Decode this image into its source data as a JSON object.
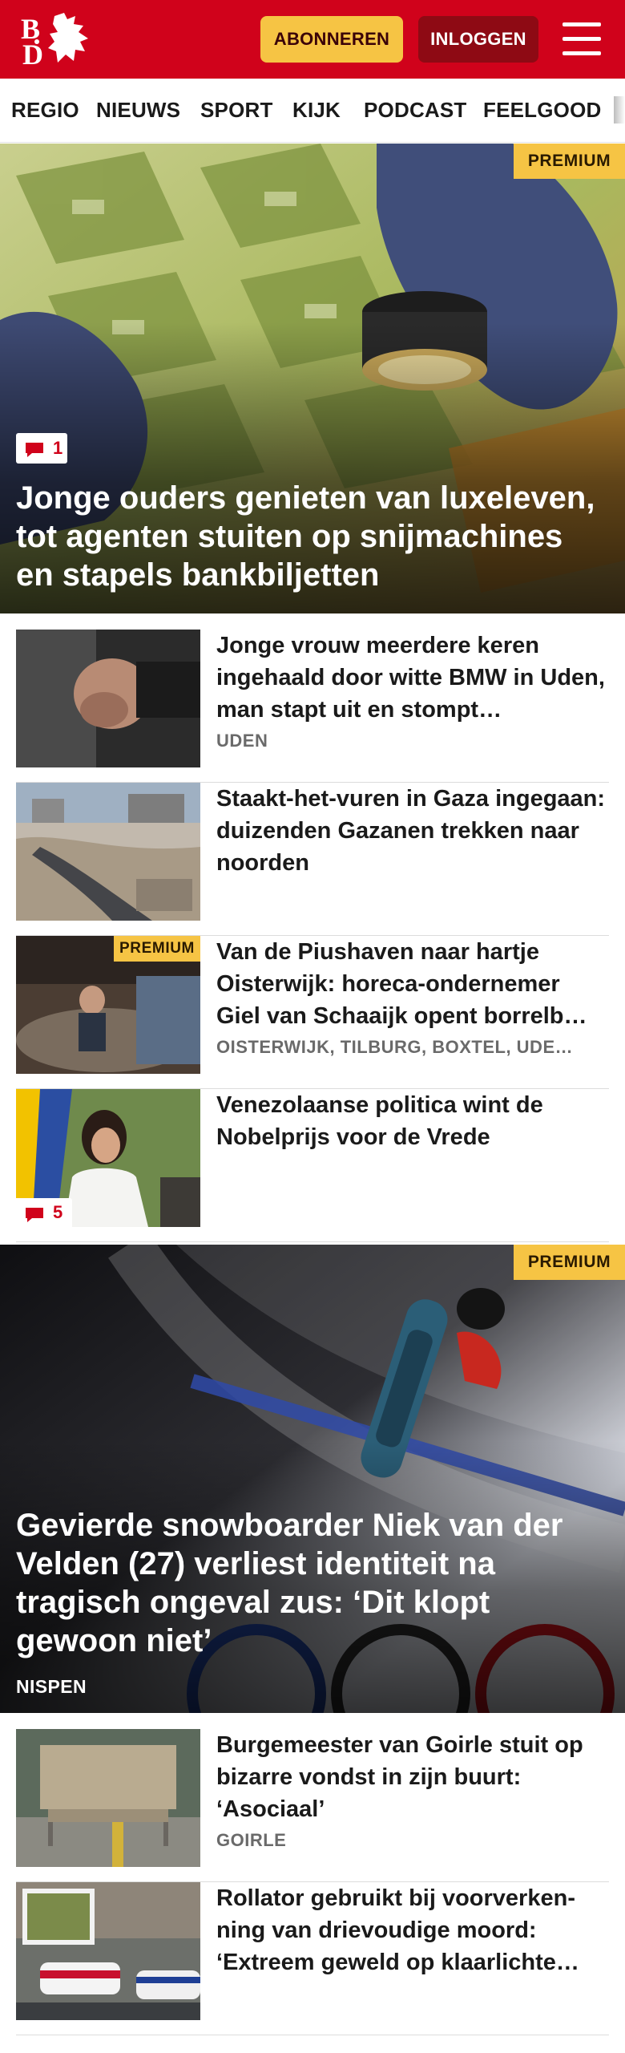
{
  "header": {
    "logo_text": "BD",
    "subscribe_label": "ABONNEREN",
    "login_label": "INLOGGEN"
  },
  "nav": {
    "items": [
      "REGIO",
      "NIEUWS",
      "SPORT",
      "KIJK",
      "PODCAST",
      "FEELGOOD"
    ]
  },
  "colors": {
    "brand_red": "#d0021b",
    "premium_yellow": "#f6c444",
    "login_dark_red": "#8e0a14"
  },
  "hero_1": {
    "badge": "PREMIUM",
    "comments": "1",
    "title": "Jonge ouders genieten van luxeleven, tot agenten stuiten op snijmachines en stapels bankbiljetten"
  },
  "articles": [
    {
      "title": "Jonge vrouw meerdere keren ingehaald door witte BMW in Uden, man stapt uit en stompt…",
      "location": "UDEN"
    },
    {
      "title": "Staakt-het-vuren in Gaza ingegaan: duizenden Gazanen trekken naar noorden",
      "location": ""
    },
    {
      "badge": "PREMIUM",
      "title": "Van de Piushaven naar hartje Oisterwijk: horeca-ondernemer Giel van Schaaijk opent borrelb…",
      "location": "OISTERWIJK, TILBURG, BOXTEL, UDE…"
    },
    {
      "title": "Venezolaanse politica wint de Nobelprijs voor de Vrede",
      "location": "",
      "comments": "5"
    }
  ],
  "hero_2": {
    "badge": "PREMIUM",
    "title": "Gevierde snowboarder Niek van der Velden (27) verliest identiteit na tragisch ongeval zus: ‘Dit klopt gewoon niet’",
    "location": "NISPEN"
  },
  "articles_2": [
    {
      "title": "Burgemeester van Goirle stuit op bizarre vondst in zijn buurt: ‘Asociaal’",
      "location": "GOIRLE"
    },
    {
      "title": "Rollator gebruikt bij voorverken­ning van drievoudige moord: ‘Extreem geweld op klaarlichte…",
      "location": ""
    }
  ]
}
